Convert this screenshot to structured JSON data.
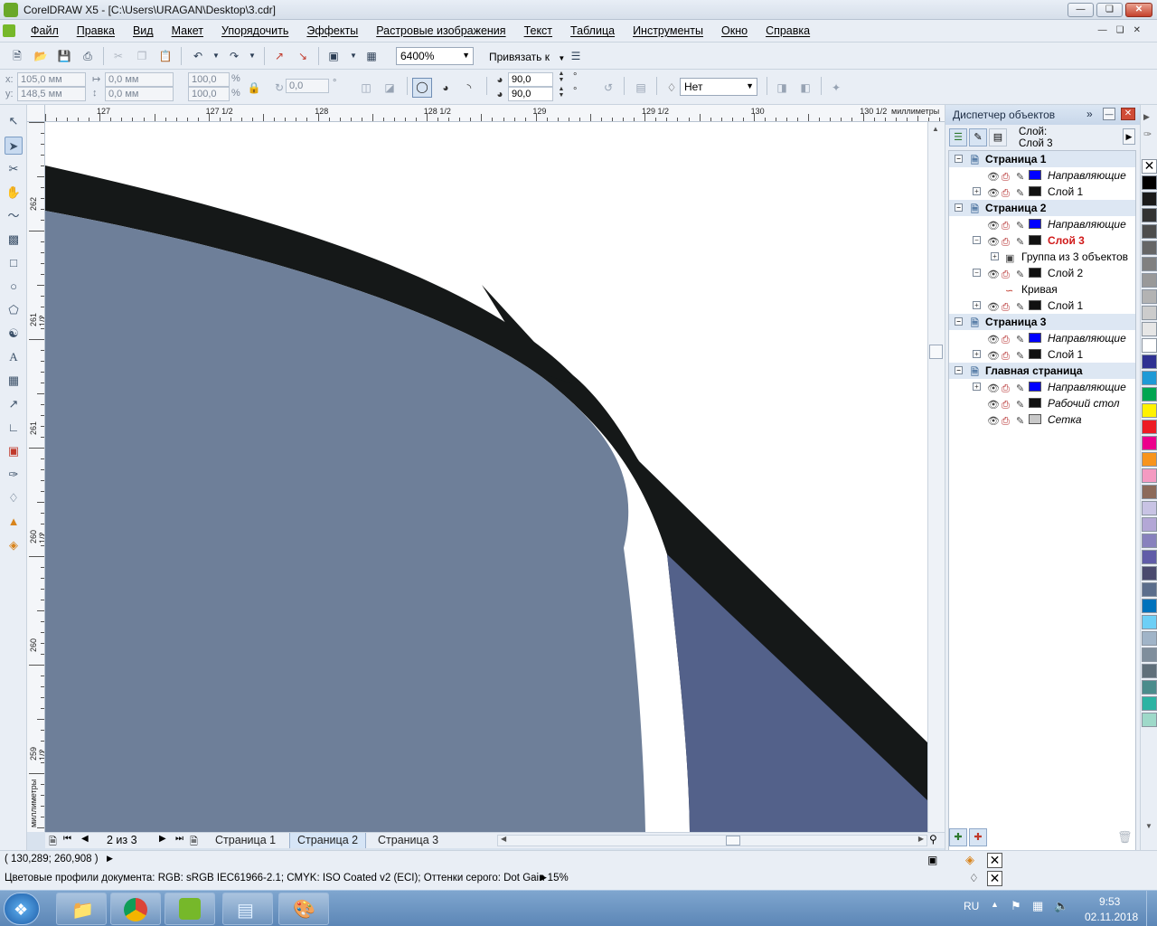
{
  "window": {
    "title": "CorelDRAW X5 - [C:\\Users\\URAGAN\\Desktop\\3.cdr]"
  },
  "menu": [
    "Файл",
    "Правка",
    "Вид",
    "Макет",
    "Упорядочить",
    "Эффекты",
    "Растровые изображения",
    "Текст",
    "Таблица",
    "Инструменты",
    "Окно",
    "Справка"
  ],
  "standard_toolbar": {
    "zoom": "6400%",
    "snap_label": "Привязать к"
  },
  "property_bar": {
    "x_label": "x:",
    "x_value": "105,0 мм",
    "y_label": "y:",
    "y_value": "148,5 мм",
    "w_value": "0,0 мм",
    "h_value": "0,0 мм",
    "scale_x": "100,0",
    "scale_y": "100,0",
    "percent": "%",
    "angle": "0,0",
    "degree": "°",
    "start_angle": "90,0",
    "end_angle": "90,0",
    "outline": "Нет"
  },
  "ruler": {
    "h_labels": [
      "127",
      "127  1/2",
      "128",
      "128  1/2",
      "129",
      "129  1/2",
      "130",
      "130  1/2"
    ],
    "unit": "миллиметры",
    "v_labels": [
      "262",
      "261  1/2",
      "261",
      "260  1/2",
      "260",
      "259  1/2",
      "миллиметры"
    ]
  },
  "page_nav": {
    "counter": "2 из 3",
    "tabs": [
      "Страница 1",
      "Страница 2",
      "Страница 3"
    ],
    "active_tab": 1
  },
  "docker": {
    "title": "Диспетчер объектов",
    "layer_label": "Слой:",
    "layer_value": "Слой 3",
    "tree": [
      {
        "type": "page",
        "label": "Страница 1"
      },
      {
        "type": "layer",
        "label": "Направляющие",
        "italic": true,
        "color": "#0000ff",
        "exp": false
      },
      {
        "type": "layer",
        "label": "Слой 1",
        "color": "#111111",
        "exp": true
      },
      {
        "type": "page",
        "label": "Страница 2"
      },
      {
        "type": "layer",
        "label": "Направляющие",
        "italic": true,
        "color": "#0000ff",
        "exp": false
      },
      {
        "type": "layer",
        "label": "Слой 3",
        "active": true,
        "color": "#111111",
        "exp": true,
        "collapse": true
      },
      {
        "type": "group",
        "label": "Группа из 3 объектов"
      },
      {
        "type": "layer",
        "label": "Слой 2",
        "color": "#111111",
        "exp": true,
        "collapse": true
      },
      {
        "type": "curve",
        "label": "Кривая"
      },
      {
        "type": "layer",
        "label": "Слой 1",
        "color": "#111111",
        "exp": true
      },
      {
        "type": "page",
        "label": "Страница 3"
      },
      {
        "type": "layer",
        "label": "Направляющие",
        "italic": true,
        "color": "#0000ff",
        "exp": false
      },
      {
        "type": "layer",
        "label": "Слой 1",
        "color": "#111111",
        "exp": true
      },
      {
        "type": "page",
        "label": "Главная страница"
      },
      {
        "type": "layer",
        "label": "Направляющие",
        "italic": true,
        "color": "#0000ff",
        "exp": true
      },
      {
        "type": "layer",
        "label": "Рабочий стол",
        "italic": true,
        "color": "#111111",
        "exp": false
      },
      {
        "type": "layer",
        "label": "Сетка",
        "italic": true,
        "color": "#c8c8c8",
        "exp": false
      }
    ]
  },
  "palette": [
    "#000000",
    "#1a1a1a",
    "#333333",
    "#4d4d4d",
    "#666666",
    "#808080",
    "#999999",
    "#b3b3b3",
    "#cccccc",
    "#e6e6e6",
    "#ffffff",
    "#2e3192",
    "#1e9ad6",
    "#00a651",
    "#fff200",
    "#ed1c24",
    "#ec008c",
    "#f7941d",
    "#f49ac1",
    "#8c6a5a",
    "#c8c3e4",
    "#b3a7d6",
    "#8781bd",
    "#605ca8",
    "#4a4a6e",
    "#5b6e8c",
    "#0072bc",
    "#6dcff6",
    "#a0b4c8",
    "#7f8e9c",
    "#5f6f7a",
    "#4a8c8c",
    "#2bb3a3",
    "#9ed9c9"
  ],
  "status": {
    "coords": "( 130,289; 260,908 )",
    "profiles": "Цветовые профили документа: RGB: sRGB IEC61966-2.1; CMYK: ISO Coated v2 (ECI); Оттенки серого: Dot Gain 15%"
  },
  "taskbar": {
    "lang": "RU",
    "time": "9:53",
    "date": "02.11.2018"
  },
  "colors": {
    "shape_fill_left": "#6e7f99",
    "shape_fill_right": "#53618a",
    "outline": "#151818"
  }
}
